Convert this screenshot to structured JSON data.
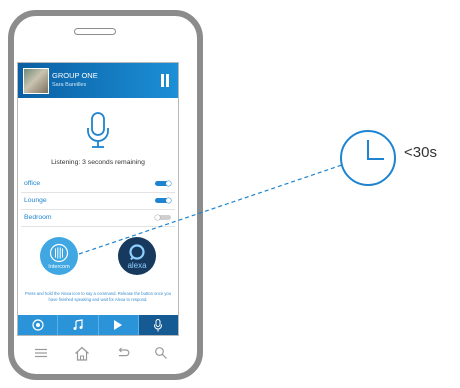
{
  "now_playing": {
    "group": "GROUP ONE",
    "artist": "Sara Bareilles"
  },
  "voice": {
    "status": "Listening: 3 seconds remaining"
  },
  "rooms": [
    {
      "label": "office",
      "enabled": true
    },
    {
      "label": "Lounge",
      "enabled": true
    },
    {
      "label": "Bedroom",
      "enabled": false
    }
  ],
  "buttons": {
    "intercom": "Intercom",
    "alexa": "alexa"
  },
  "instructions": "Press and hold the Alexa icon to say a command. Release the button once you have finished speaking and wait for Alexa to respond.",
  "tabs": [
    {
      "icon": "speaker-icon",
      "active": false
    },
    {
      "icon": "music-note-icon",
      "active": false
    },
    {
      "icon": "play-icon",
      "active": false
    },
    {
      "icon": "microphone-icon",
      "active": true
    }
  ],
  "annotation": {
    "time": "<30s"
  },
  "colors": {
    "brand_blue": "#1e84cf",
    "header_dark": "#0a5fa3",
    "alexa_navy": "#16395d",
    "intercom_blue": "#40a7e3",
    "tab_blue": "#2b94d8",
    "tab_active": "#155a92"
  }
}
